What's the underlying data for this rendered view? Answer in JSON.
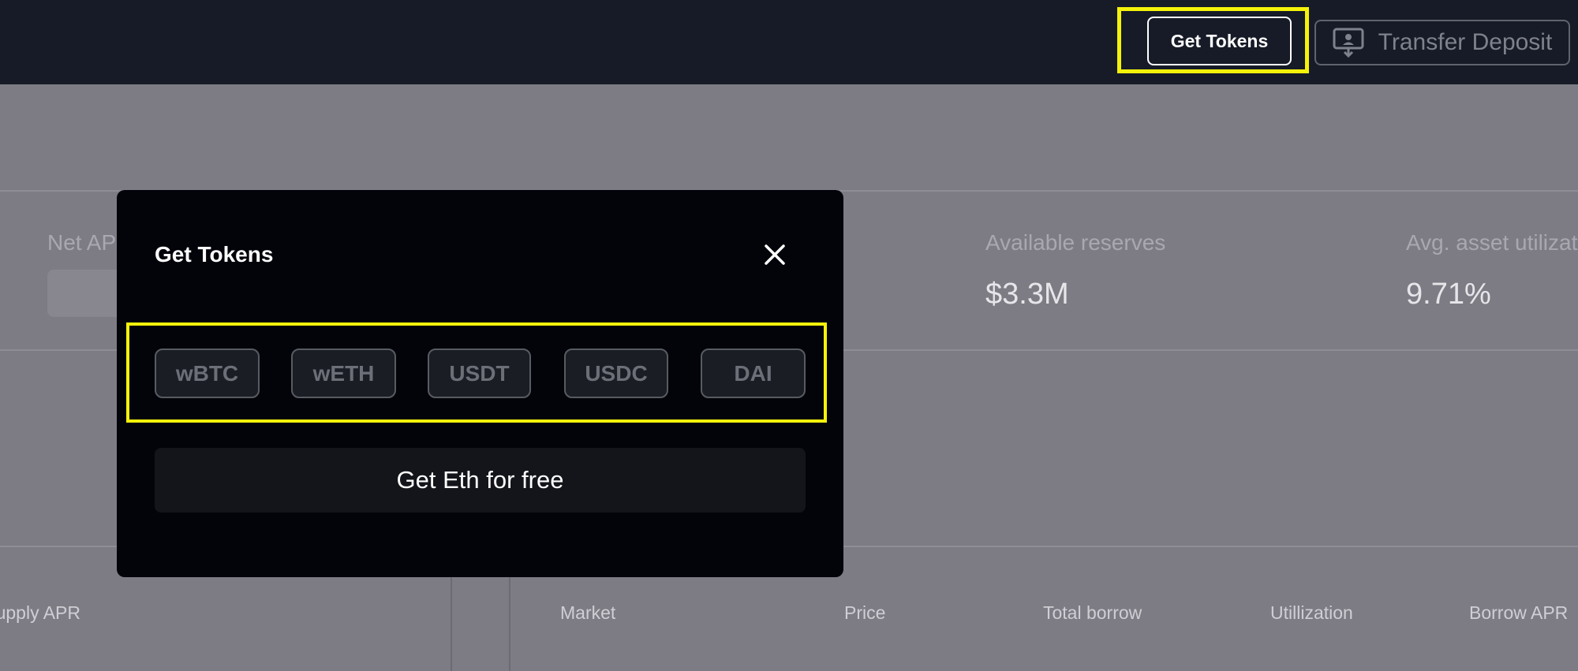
{
  "header": {
    "get_tokens_label": "Get Tokens",
    "transfer_label": "Transfer Deposit",
    "transfer_icon": "transfer-deposit-icon"
  },
  "stats": {
    "net_apr_label": "Net APR",
    "available_label": "Available reserves",
    "available_value": "$3.3M",
    "utilization_label": "Avg. asset utilization",
    "utilization_value": "9.71%"
  },
  "table": {
    "supply_apr": "Supply APR",
    "market": "Market",
    "price": "Price",
    "total_borrow": "Total borrow",
    "utilization": "Utillization",
    "borrow_apr": "Borrow APR"
  },
  "modal": {
    "title": "Get Tokens",
    "close_icon": "close-icon",
    "tokens": [
      "wBTC",
      "wETH",
      "USDT",
      "USDC",
      "DAI"
    ],
    "eth_button": "Get Eth for free"
  },
  "colors": {
    "highlight": "#f5f20a",
    "topbar": "#161b27",
    "modal": "#02040a",
    "overlay": "#7d7c85"
  }
}
